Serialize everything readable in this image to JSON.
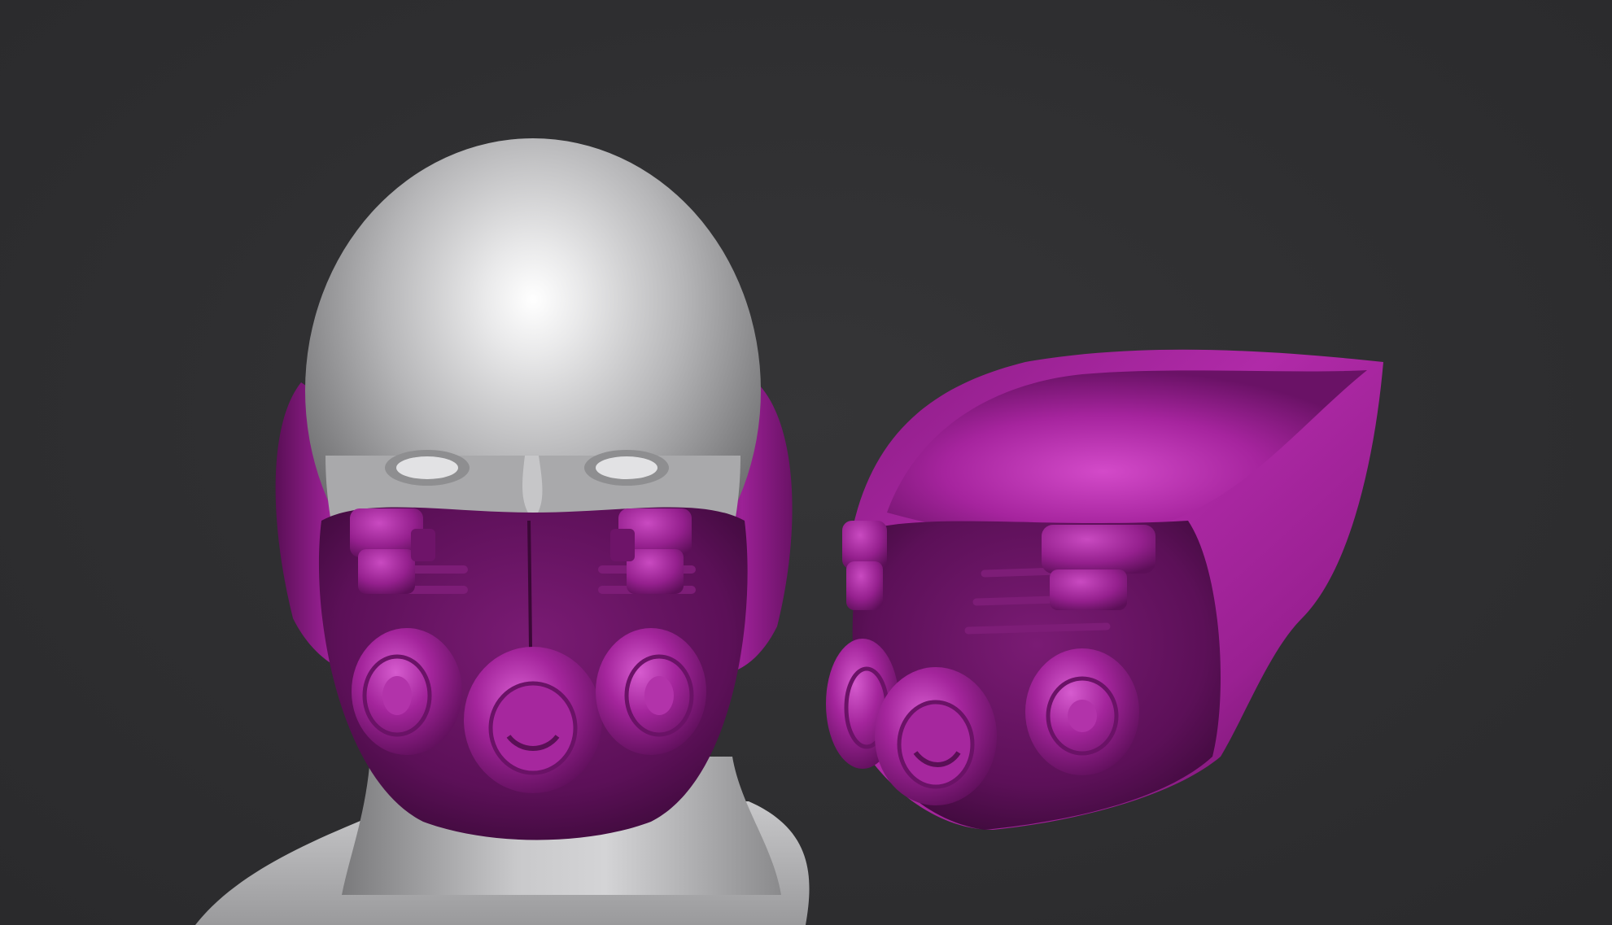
{
  "scene": {
    "subjects": [
      {
        "name": "head-with-mask-front-view",
        "colors": {
          "head": "#cfcfd1",
          "mask": "#8a1a80"
        }
      },
      {
        "name": "mask-three-quarter-view",
        "colors": {
          "mask": "#9a1f90"
        }
      }
    ],
    "background_color": "#2f2f31",
    "accent_color": "#a022a0"
  }
}
